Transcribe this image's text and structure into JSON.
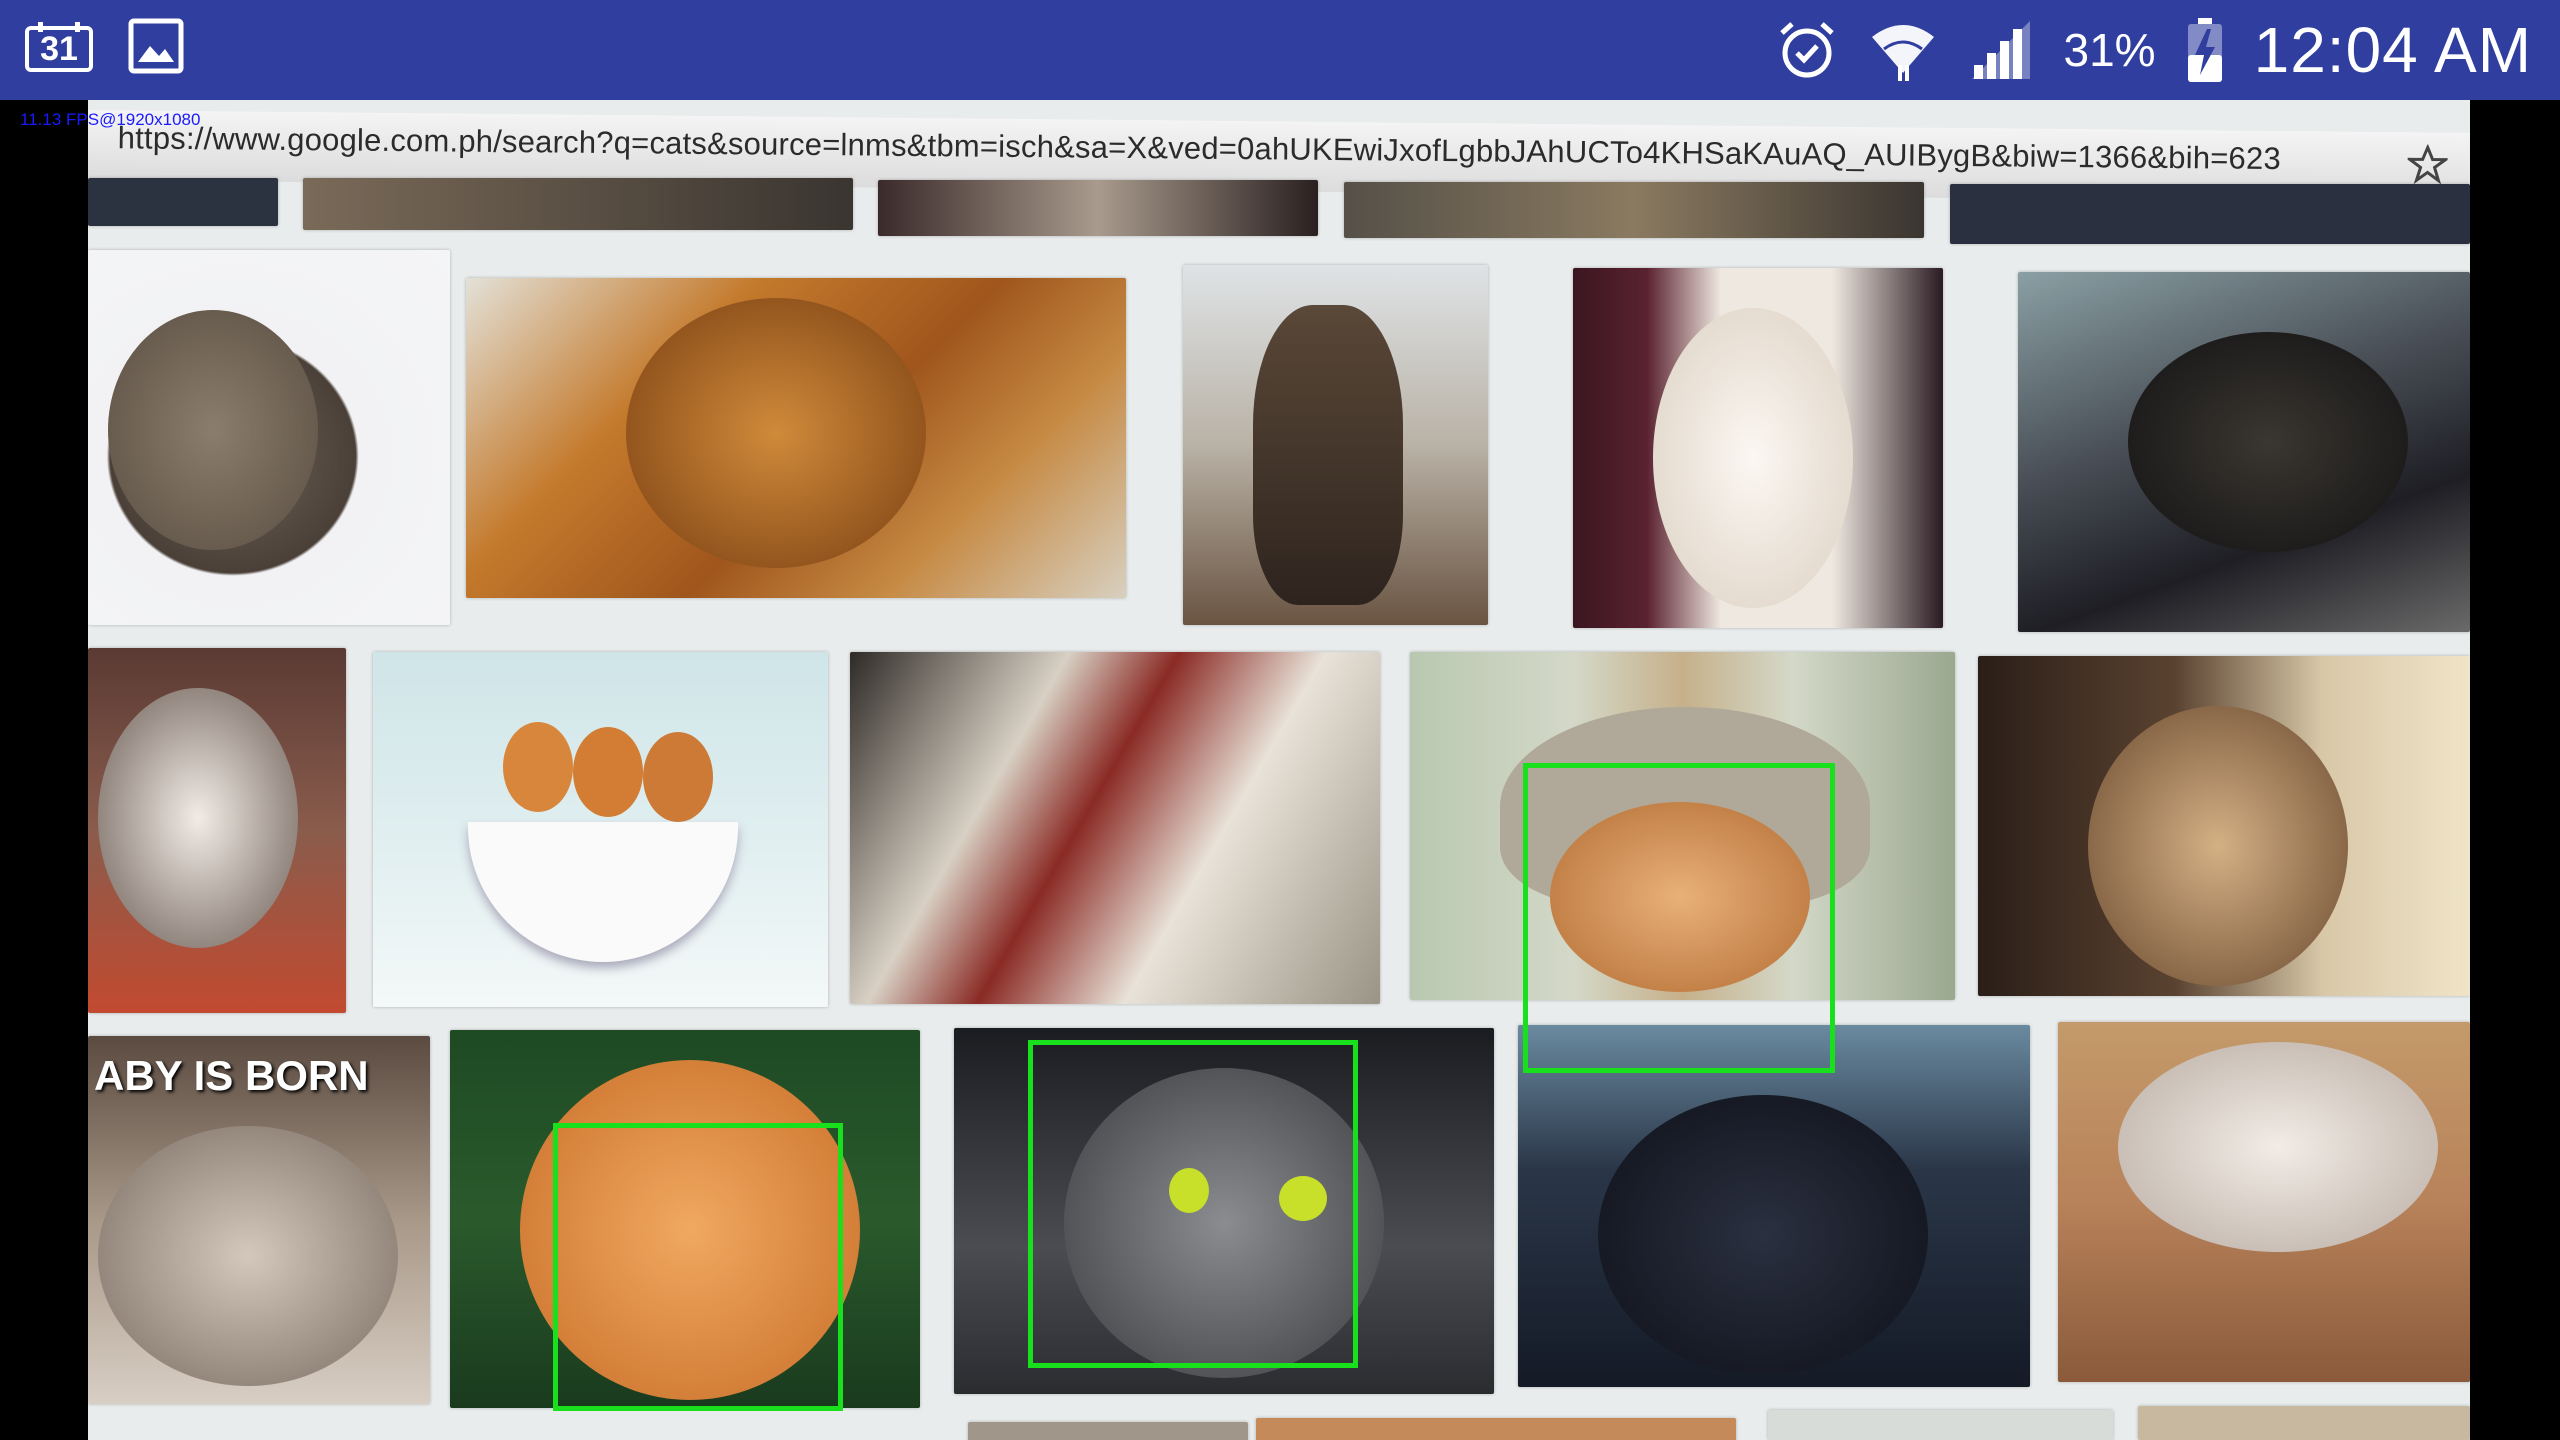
{
  "status_bar": {
    "left_icons": [
      "calendar-icon",
      "gallery-icon"
    ],
    "calendar_day": "31",
    "right_icons": [
      "alarm-icon",
      "wifi-icon",
      "signal-icon",
      "battery-charging-icon"
    ],
    "battery_percent": "31%",
    "time": "12:04 AM",
    "background": "#303f9f"
  },
  "overlay": {
    "fps_text": "11.13 FPS@1920x1080"
  },
  "browser": {
    "url": "https://www.google.com.ph/search?q=cats&source=lnms&tbm=isch&sa=X&ved=0ahUKEwiJxofLgbbJAhUCTo4KHSaKAuAQ_AUIBygB&biw=1366&bih=623",
    "bookmark_icon": "star-icon"
  },
  "results": {
    "caption_text": "ABY IS BORN",
    "images": [
      {
        "id": "row1-cat-1",
        "tone": "#8a7a68"
      },
      {
        "id": "row1-cat-2",
        "tone": "#b9762e"
      },
      {
        "id": "row1-cat-3",
        "tone": "#6b5848"
      },
      {
        "id": "row1-cat-4",
        "tone": "#e8dccf"
      },
      {
        "id": "row1-cat-5",
        "tone": "#2e2e34"
      },
      {
        "id": "row2-cat-1",
        "tone": "#d9d2cc"
      },
      {
        "id": "row2-cats-in-cup",
        "tone": "#d8eaec"
      },
      {
        "id": "row2-cat-3",
        "tone": "#c8bfb4"
      },
      {
        "id": "row2-cat-hat-glasses",
        "tone": "#c9b48c"
      },
      {
        "id": "row2-cat-5",
        "tone": "#7a5e46"
      },
      {
        "id": "row3-kitten-caption",
        "tone": "#cbbfb2"
      },
      {
        "id": "row3-ginger-cat",
        "tone": "#d88a3c"
      },
      {
        "id": "row3-gray-cat",
        "tone": "#4a4c50"
      },
      {
        "id": "row3-black-cat",
        "tone": "#1d2432"
      },
      {
        "id": "row3-sleeping-kitten",
        "tone": "#b08c6c"
      }
    ]
  },
  "detections": {
    "box_color": "#19e01c",
    "count": 3
  }
}
